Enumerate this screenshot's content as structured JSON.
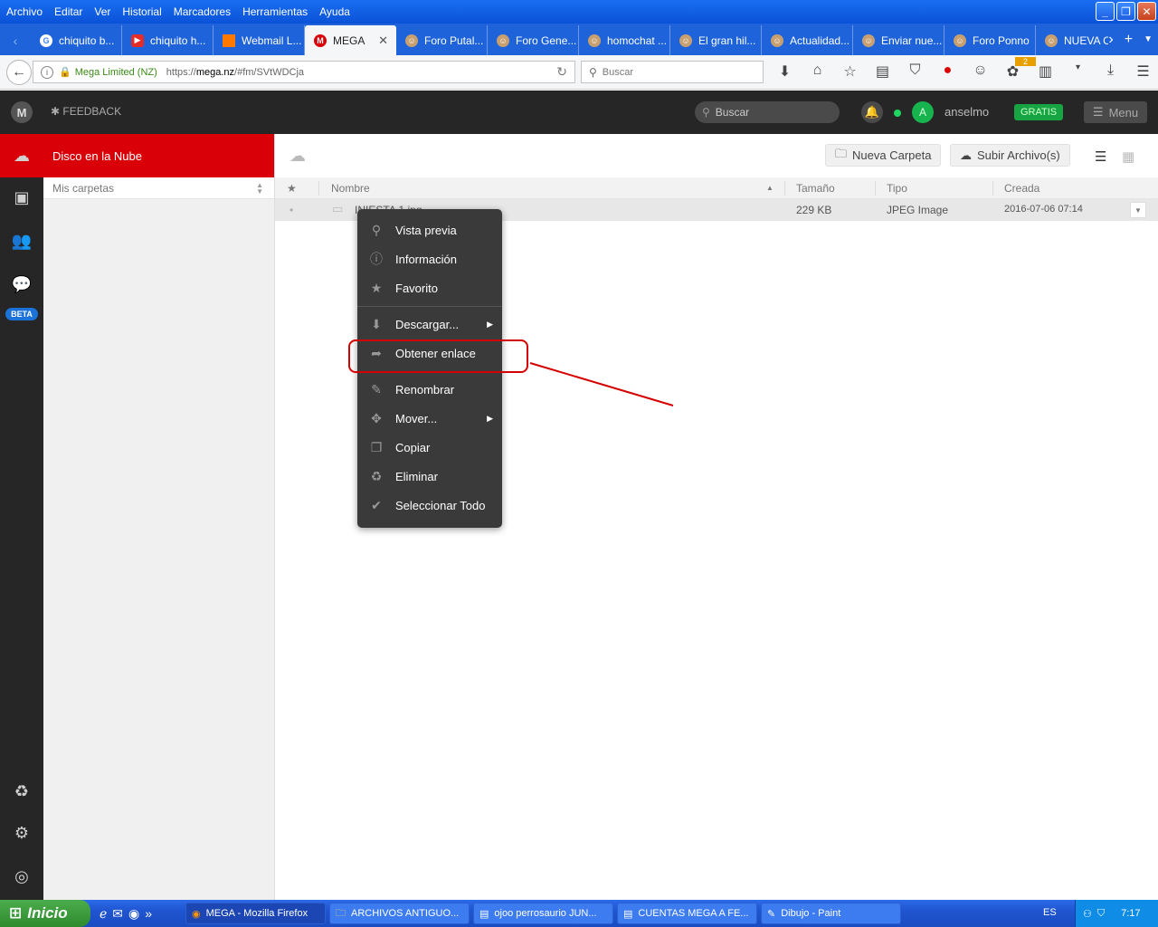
{
  "menubar": [
    "Archivo",
    "Editar",
    "Ver",
    "Historial",
    "Marcadores",
    "Herramientas",
    "Ayuda"
  ],
  "tabs": [
    {
      "label": "chiquito b...",
      "icon": "google-icon",
      "color": "#ffffff"
    },
    {
      "label": "chiquito h...",
      "icon": "youtube-icon",
      "color": "#e52d27"
    },
    {
      "label": "Webmail L...",
      "icon": "orange-icon",
      "color": "#ff7900"
    },
    {
      "label": "MEGA",
      "icon": "mega-icon",
      "color": "#d90007",
      "active": true
    },
    {
      "label": "Foro Putal...",
      "icon": "forum-icon",
      "color": "#c8a070"
    },
    {
      "label": "Foro Gene...",
      "icon": "forum-icon",
      "color": "#c8a070"
    },
    {
      "label": "homochat ...",
      "icon": "forum-icon",
      "color": "#c8a070"
    },
    {
      "label": "El gran hil...",
      "icon": "forum-icon",
      "color": "#c8a070"
    },
    {
      "label": "Actualidad...",
      "icon": "forum-icon",
      "color": "#c8a070"
    },
    {
      "label": "Enviar nue...",
      "icon": "forum-icon",
      "color": "#c8a070"
    },
    {
      "label": "Foro Ponno",
      "icon": "forum-icon",
      "color": "#c8a070"
    },
    {
      "label": "NUEVA CU",
      "icon": "forum-icon",
      "color": "#c8a070"
    }
  ],
  "urlbar": {
    "identity": "Mega Limited (NZ)",
    "url_prefix": "https://",
    "url_host": "mega.nz",
    "url_path": "/#fm/SVtWDCja"
  },
  "searchbar": {
    "placeholder": "Buscar"
  },
  "badge_count": "2",
  "mega": {
    "feedback": "FEEDBACK",
    "search_placeholder": "Buscar",
    "avatar_letter": "A",
    "username": "anselmo",
    "plan": "GRATIS",
    "menu": "Menu",
    "beta": "BETA"
  },
  "tree": {
    "title": "Disco en la Nube",
    "subtitle": "Mis carpetas"
  },
  "toolbar": {
    "new_folder": "Nueva Carpeta",
    "upload": "Subir Archivo(s)"
  },
  "columns": {
    "name": "Nombre",
    "size": "Tamaño",
    "type": "Tipo",
    "created": "Creada"
  },
  "file": {
    "name": "INIESTA 1.jpg",
    "size": "229 KB",
    "type": "JPEG Image",
    "created": "2016-07-06 07:14"
  },
  "context_menu": {
    "preview": "Vista previa",
    "info": "Información",
    "favourite": "Favorito",
    "download": "Descargar...",
    "get_link": "Obtener enlace",
    "rename": "Renombrar",
    "move": "Mover...",
    "copy": "Copiar",
    "delete": "Eliminar",
    "select_all": "Seleccionar Todo"
  },
  "taskbar": {
    "start": "Inicio",
    "windows": [
      "MEGA - Mozilla Firefox",
      "ARCHIVOS ANTIGUO...",
      "ojoo perrosaurio JUN...",
      "CUENTAS MEGA A FE...",
      "Dibujo - Paint"
    ],
    "lang": "ES",
    "clock": "7:17"
  },
  "colors": {
    "mega_red": "#d90007",
    "mega_dark": "#262626",
    "gratis_green": "#17a543",
    "xp_blue": "#1f55d0"
  }
}
